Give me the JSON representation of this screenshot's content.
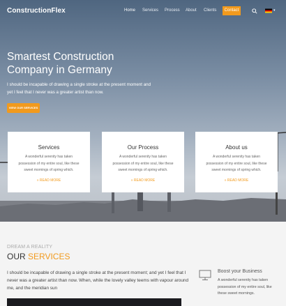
{
  "brand": {
    "logo": "ConstructionFlex"
  },
  "nav": {
    "items": [
      "Home",
      "Services",
      "Process",
      "About",
      "Clients"
    ],
    "contact": "Contact",
    "search_icon": "search-icon",
    "language_icon": "german-flag-icon",
    "language_arrow": "▾"
  },
  "hero": {
    "title_line1": "Smartest Construction",
    "title_line2": "Company in Germany",
    "text": "I should be incapable of drawing a single stroke at the present moment and yet I feel that I never was a greater artist than now.",
    "button": "VIEW OUR SERVICES"
  },
  "cards": [
    {
      "title": "Services",
      "text": "A wonderful serenity has taken possession of my entire soul, like these sweet mornings of spring which.",
      "link": "» READ MORE"
    },
    {
      "title": "Our Process",
      "text": "A wonderful serenity has taken possession of my entire soul, like these sweet mornings of spring which.",
      "link": "» READ MORE"
    },
    {
      "title": "About us",
      "text": "A wonderful serenity has taken possession of my entire soul, like these sweet mornings of spring which.",
      "link": "» READ MORE"
    }
  ],
  "services_section": {
    "overline": "DREAM A REALITY",
    "title_plain": "OUR ",
    "title_accent": "SERVICES",
    "text": "I should be incapable of drawing a single stroke at the present moment; and yet I feel that I never was a greater artist than now. When, while the lovely valley teems with vapour around me, and the meridian sun",
    "feature": {
      "icon": "monitor-icon",
      "title": "Boost your Business",
      "text": "A wonderful serenity has taken possession of my entire soul, like these sweet mornings."
    }
  },
  "colors": {
    "accent": "#f29a1d",
    "text_dark": "#333333",
    "background": "#f4f4f4"
  }
}
